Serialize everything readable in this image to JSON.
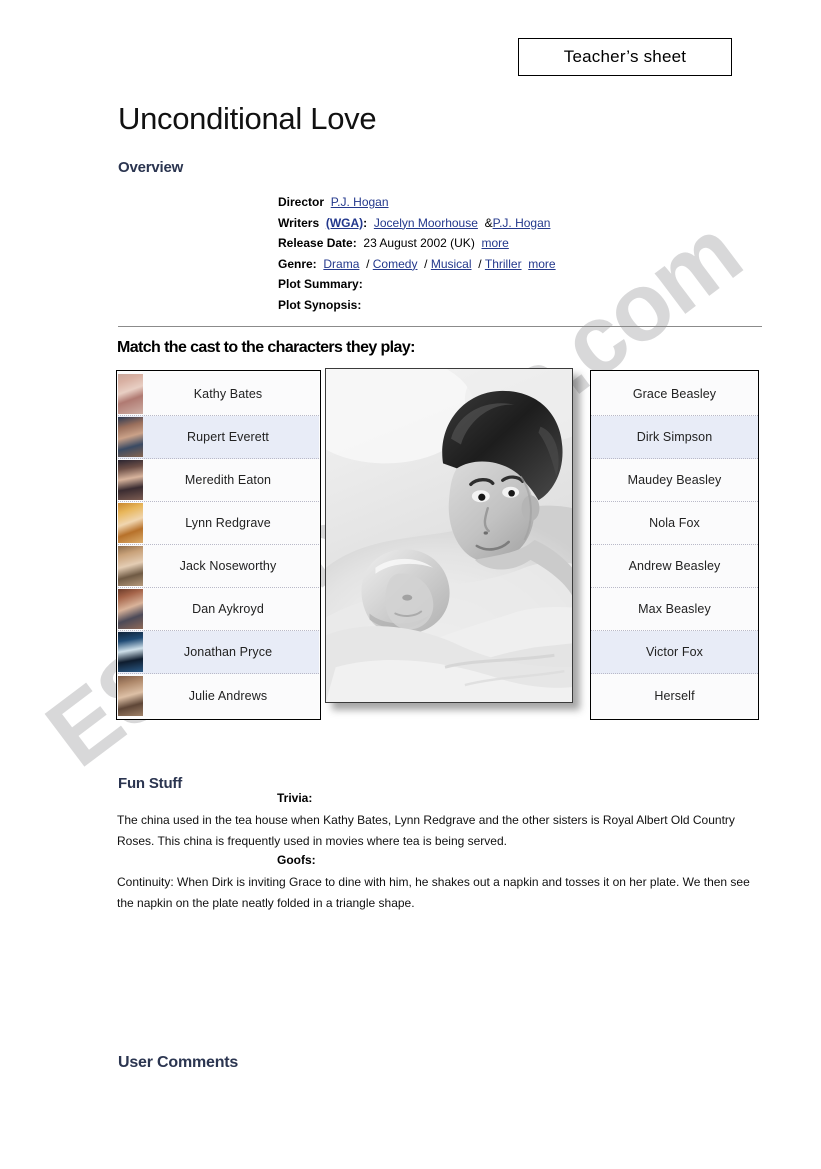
{
  "header": {
    "badge_label": "Teacher’s sheet"
  },
  "title": "Unconditional Love",
  "sections": {
    "overview": "Overview",
    "fun_stuff": "Fun Stuff",
    "user_comments": "User Comments",
    "match_instruction": "Match the cast to the characters they play:"
  },
  "overview": {
    "director_label": "Director",
    "director_name": "P.J. Hogan",
    "writers_label": "Writers",
    "writers_wga": "(WGA)",
    "writers_colon": ":",
    "writer_1": "Jocelyn Moorhouse",
    "writers_amp": "&",
    "writer_2": "P.J. Hogan",
    "release_label": "Release Date:",
    "release_value": "23 August 2002 (UK)",
    "release_more": "more",
    "genre_label": "Genre:",
    "genre_1": "Drama",
    "genre_2": "Comedy",
    "genre_3": "Musical",
    "genre_4": "Thriller",
    "genre_more": "more",
    "genre_sep": "/",
    "plot_summary_label": "Plot Summary:",
    "plot_synopsis_label": "Plot Synopsis:"
  },
  "cast": [
    {
      "name": "Kathy Bates",
      "shade": "alt-off"
    },
    {
      "name": "Rupert Everett",
      "shade": "alt-on"
    },
    {
      "name": "Meredith Eaton",
      "shade": "alt-off"
    },
    {
      "name": "Lynn Redgrave",
      "shade": "alt-off"
    },
    {
      "name": "Jack Noseworthy",
      "shade": "alt-off"
    },
    {
      "name": "Dan Aykroyd",
      "shade": "alt-off"
    },
    {
      "name": "Jonathan Pryce",
      "shade": "alt-on"
    },
    {
      "name": "Julie Andrews",
      "shade": "alt-off"
    }
  ],
  "characters": [
    {
      "name": "Grace Beasley",
      "shade": "alt-off"
    },
    {
      "name": "Dirk Simpson",
      "shade": "alt-on"
    },
    {
      "name": "Maudey Beasley",
      "shade": "alt-off"
    },
    {
      "name": "Nola Fox",
      "shade": "alt-off"
    },
    {
      "name": "Andrew Beasley",
      "shade": "alt-off"
    },
    {
      "name": "Max Beasley",
      "shade": "alt-off"
    },
    {
      "name": "Victor Fox",
      "shade": "alt-on"
    },
    {
      "name": "Herself",
      "shade": "alt-off"
    }
  ],
  "fun_stuff": {
    "trivia_label": "Trivia:",
    "trivia_text": "The china used in the tea house when Kathy Bates, Lynn Redgrave and the other sisters is Royal Albert Old Country Roses. This china is frequently used in movies where tea is being served.",
    "goofs_label": "Goofs:",
    "goofs_text": "Continuity: When Dirk is inviting Grace to dine with him, he shakes out a napkin and tosses it on her plate. We then see the napkin on the plate neatly folded in a triangle shape."
  },
  "watermark": {
    "text": "ESLprintables.com"
  },
  "colors": {
    "heading_navy": "#2b3550",
    "link_blue": "#23388c",
    "row_highlight": "#e8ecf7",
    "divider_gray": "#8b8b8b"
  },
  "media": {
    "movie_still_alt": "black-and-white film still of a man in bed looking over a sleeping woman"
  }
}
